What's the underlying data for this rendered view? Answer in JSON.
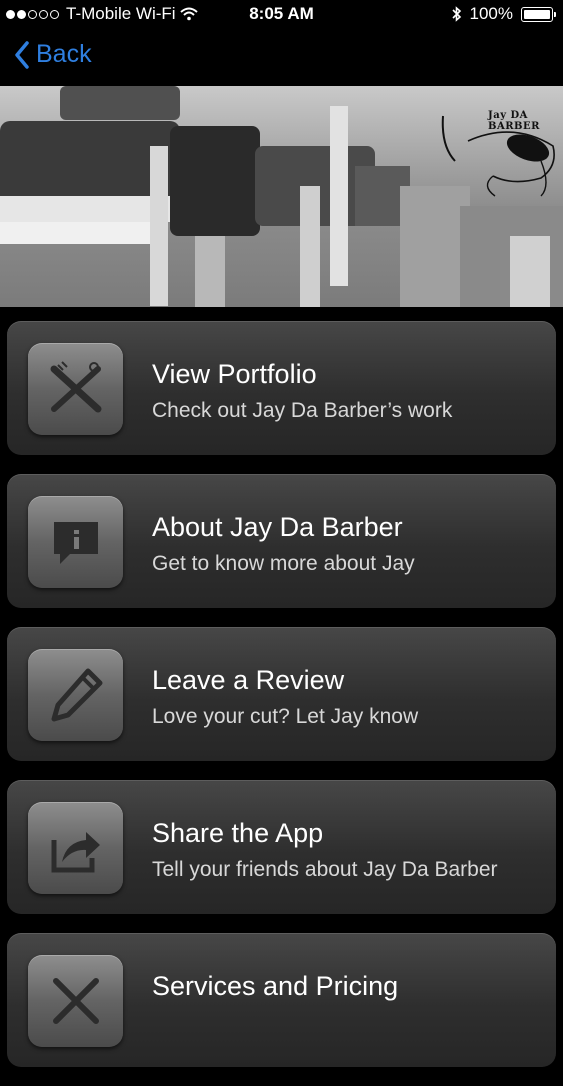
{
  "status_bar": {
    "carrier": "T-Mobile Wi-Fi",
    "time": "8:05 AM",
    "battery": "100%"
  },
  "nav": {
    "back_label": "Back"
  },
  "hero": {
    "logo_text": "Jay DA BARBER"
  },
  "menu": {
    "items": [
      {
        "title": "View Portfolio",
        "subtitle": "Check out Jay Da Barber’s work",
        "icon": "scissors-comb-icon"
      },
      {
        "title": "About Jay Da Barber",
        "subtitle": "Get to know more about Jay",
        "icon": "info-chat-icon"
      },
      {
        "title": "Leave a Review",
        "subtitle": "Love your cut? Let Jay know",
        "icon": "pencil-icon"
      },
      {
        "title": "Share the App",
        "subtitle": "Tell your friends about Jay Da Barber",
        "icon": "share-icon"
      },
      {
        "title": "Services and Pricing",
        "subtitle": "",
        "icon": "scissors-icon"
      }
    ]
  },
  "colors": {
    "accent": "#2f7fe0",
    "background": "#000000",
    "card": "#333333"
  }
}
